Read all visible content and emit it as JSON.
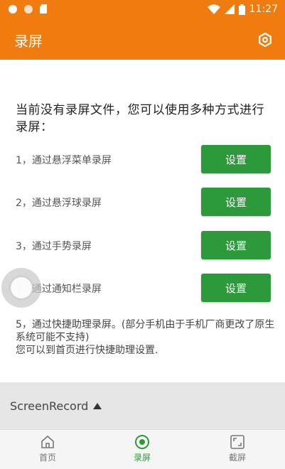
{
  "status_bar": {
    "time": "11:27"
  },
  "app_bar": {
    "title": "录屏"
  },
  "intro_text": "当前没有录屏文件，您可以使用多种方式进行录屏：",
  "methods": [
    {
      "label": "1，通过悬浮菜单录屏",
      "button": "设置"
    },
    {
      "label": "2，通过悬浮球录屏",
      "button": "设置"
    },
    {
      "label": "3，通过手势录屏",
      "button": "设置"
    },
    {
      "label": "4，通过通知栏录屏",
      "button": "设置"
    }
  ],
  "note_line1": "5，通过快捷助理录屏。(部分手机由于手机厂商更改了原生系统可能不支持)",
  "note_line2": "您可以到首页进行快捷助理设置.",
  "ad": {
    "label": "ScreenRecord"
  },
  "bottom_nav": [
    {
      "label": "首页",
      "icon": "home-icon",
      "active": false
    },
    {
      "label": "录屏",
      "icon": "record-icon",
      "active": true
    },
    {
      "label": "截屏",
      "icon": "screenshot-icon",
      "active": false
    }
  ],
  "colors": {
    "primary": "#f07b0e",
    "accent": "#2c9a3a"
  }
}
